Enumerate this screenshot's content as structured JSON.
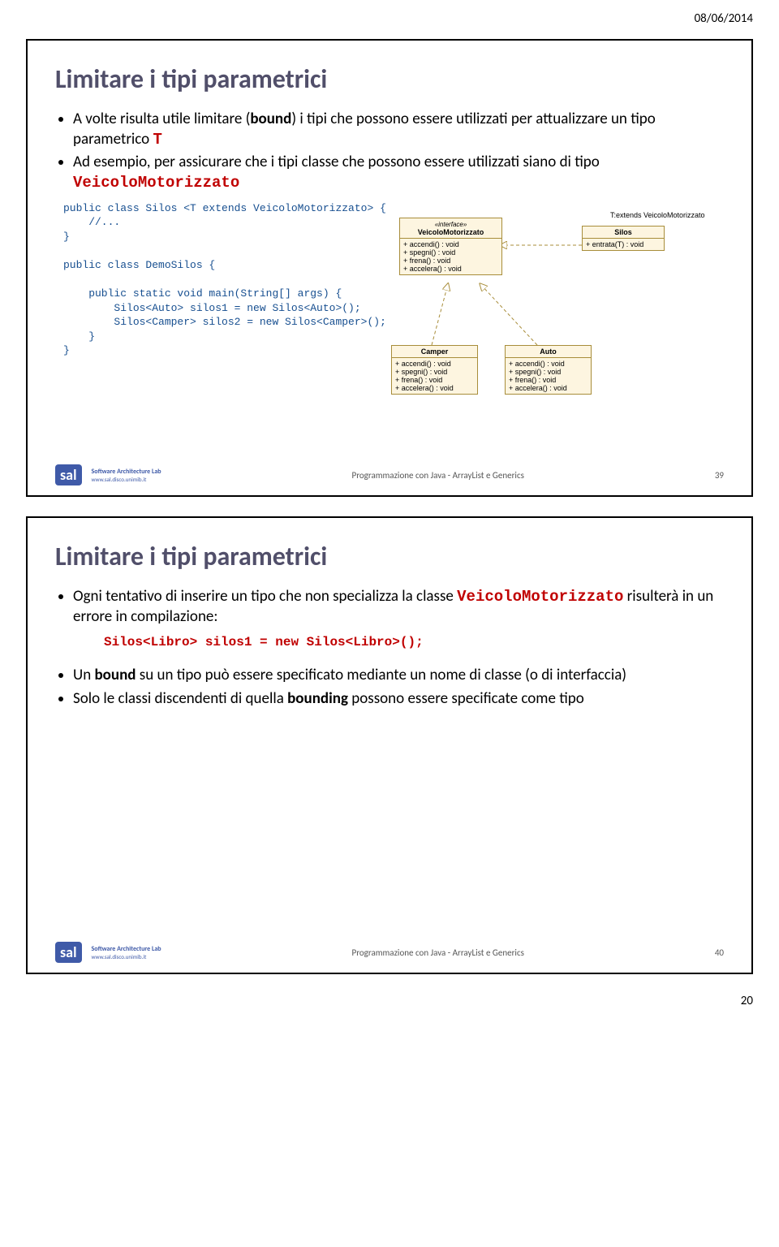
{
  "header_date": "08/06/2014",
  "page_number": "20",
  "slide1": {
    "title": "Limitare i tipi parametrici",
    "bullets": [
      "A volte risulta utile limitare (<b>bound</b>) i tipi che possono essere utilizzati per attualizzare un tipo parametrico <span class='code-red'>T</span>",
      "Ad esempio, per assicurare che i tipi classe che possono essere utilizzati siano di tipo <span class='code-red'>VeicoloMotorizzato</span>"
    ],
    "code": "public class Silos <T extends VeicoloMotorizzato> {\n    //...\n}\n\npublic class DemoSilos {\n\n    public static void main(String[] args) {\n        Silos<Auto> silos1 = new Silos<Auto>();\n        Silos<Camper> silos2 = new Silos<Camper>();\n    }\n}",
    "uml": {
      "veicolo": {
        "stereo": "«interface»",
        "name": "VeicoloMotorizzato",
        "ops": [
          "+  accendi() : void",
          "+  spegni() : void",
          "+  frena() : void",
          "+  accelera() : void"
        ]
      },
      "silos": {
        "name": "Silos",
        "ops": [
          "+  entrata(T) : void"
        ]
      },
      "constraint": "T:extends VeicoloMotorizzato",
      "camper": {
        "name": "Camper",
        "ops": [
          "+  accendi() : void",
          "+  spegni() : void",
          "+  frena() : void",
          "+  accelera() : void"
        ]
      },
      "auto": {
        "name": "Auto",
        "ops": [
          "+  accendi() : void",
          "+  spegni() : void",
          "+  frena() : void",
          "+  accelera() : void"
        ]
      }
    },
    "footer_center": "Programmazione con Java - ArrayList e Generics",
    "slide_number": "39"
  },
  "slide2": {
    "title": "Limitare i tipi parametrici",
    "bullets_top": [
      "Ogni tentativo di inserire un tipo che non specializza la classe <span class='code-red'>VeicoloMotorizzato</span> risulterà in un errore in compilazione:"
    ],
    "error_code": "Silos<Libro> silos1 = new Silos<Libro>();",
    "bullets_bottom": [
      "Un <b>bound</b> su un tipo può essere specificato mediante un nome di classe (o di interfaccia)",
      "Solo le classi discendenti di quella <b>bounding</b> possono essere specificate come tipo"
    ],
    "footer_center": "Programmazione con Java - ArrayList e Generics",
    "slide_number": "40"
  },
  "footer_left": {
    "badge": "sal",
    "line1": "Software Architecture Lab",
    "line2": "www.sal.disco.unimib.it"
  }
}
